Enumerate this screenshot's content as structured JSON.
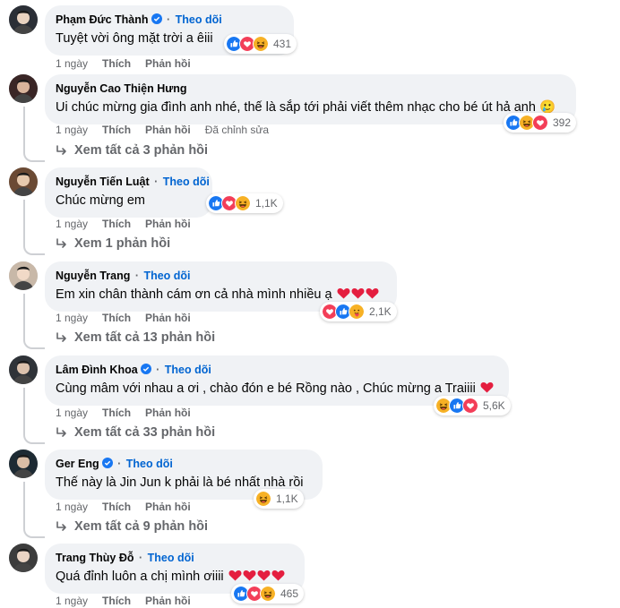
{
  "comments": [
    {
      "name": "Phạm Đức Thành",
      "verified": true,
      "follow": "Theo dõi",
      "text": "Tuyệt vời ông mặt trời a êiii",
      "hearts": 0,
      "trailing_emoji": "",
      "reactions": [
        "like",
        "love",
        "haha"
      ],
      "count": "431",
      "time": "1 ngày",
      "like": "Thích",
      "reply": "Phản hồi",
      "edited": "",
      "view_replies": ""
    },
    {
      "name": "Nguyễn Cao Thiện Hưng",
      "verified": false,
      "follow": "",
      "text": "Ui chúc mừng gia đình anh nhé, thế là sắp tới phải viết thêm nhạc cho bé út hả anh",
      "hearts": 0,
      "trailing_emoji": "🥲",
      "reactions": [
        "like",
        "haha",
        "love"
      ],
      "count": "392",
      "time": "1 ngày",
      "like": "Thích",
      "reply": "Phản hồi",
      "edited": "Đã chỉnh sửa",
      "view_replies": "Xem tất cả 3 phản hồi"
    },
    {
      "name": "Nguyễn Tiến Luật",
      "verified": false,
      "follow": "Theo dõi",
      "text": "Chúc mừng em",
      "hearts": 0,
      "trailing_emoji": "",
      "reactions": [
        "like",
        "love",
        "haha"
      ],
      "count": "1,1K",
      "time": "1 ngày",
      "like": "Thích",
      "reply": "Phản hồi",
      "edited": "",
      "view_replies": "Xem 1 phản hồi"
    },
    {
      "name": "Nguyễn Trang",
      "verified": false,
      "follow": "Theo dõi",
      "text": "Em xin chân thành cám ơn cả nhà mình nhiều ạ",
      "hearts": 3,
      "trailing_emoji": "",
      "reactions": [
        "love",
        "like",
        "care"
      ],
      "count": "2,1K",
      "time": "1 ngày",
      "like": "Thích",
      "reply": "Phản hồi",
      "edited": "",
      "view_replies": "Xem tất cả 13 phản hồi"
    },
    {
      "name": "Lâm Đình Khoa",
      "verified": true,
      "follow": "Theo dõi",
      "text": "Cùng mâm với nhau a ơi , chào đón e bé Rồng nào , Chúc mừng a Traiiii",
      "hearts": 1,
      "trailing_emoji": "",
      "reactions": [
        "haha",
        "like",
        "love"
      ],
      "count": "5,6K",
      "time": "1 ngày",
      "like": "Thích",
      "reply": "Phản hồi",
      "edited": "",
      "view_replies": "Xem tất cả 33 phản hồi"
    },
    {
      "name": "Ger Eng",
      "verified": true,
      "follow": "Theo dõi",
      "text": "Thế này là Jin Jun k phải là bé nhất nhà rồi",
      "hearts": 0,
      "trailing_emoji": "",
      "reactions": [
        "haha"
      ],
      "count": "1,1K",
      "time": "1 ngày",
      "like": "Thích",
      "reply": "Phản hồi",
      "edited": "",
      "view_replies": "Xem tất cả 9 phản hồi"
    },
    {
      "name": "Trang Thùy Đỗ",
      "verified": false,
      "follow": "Theo dõi",
      "text": "Quá đỉnh luôn a chị mình ơiiii",
      "hearts": 4,
      "trailing_emoji": "",
      "reactions": [
        "like",
        "love",
        "haha"
      ],
      "count": "465",
      "time": "1 ngày",
      "like": "Thích",
      "reply": "Phản hồi",
      "edited": "",
      "view_replies": ""
    }
  ],
  "colors": {
    "like": "#1877f2",
    "love": "#f33e58",
    "haha": "#f7b125",
    "follow": "#0064d1",
    "bubble": "#f0f2f5",
    "meta": "#65676b"
  }
}
